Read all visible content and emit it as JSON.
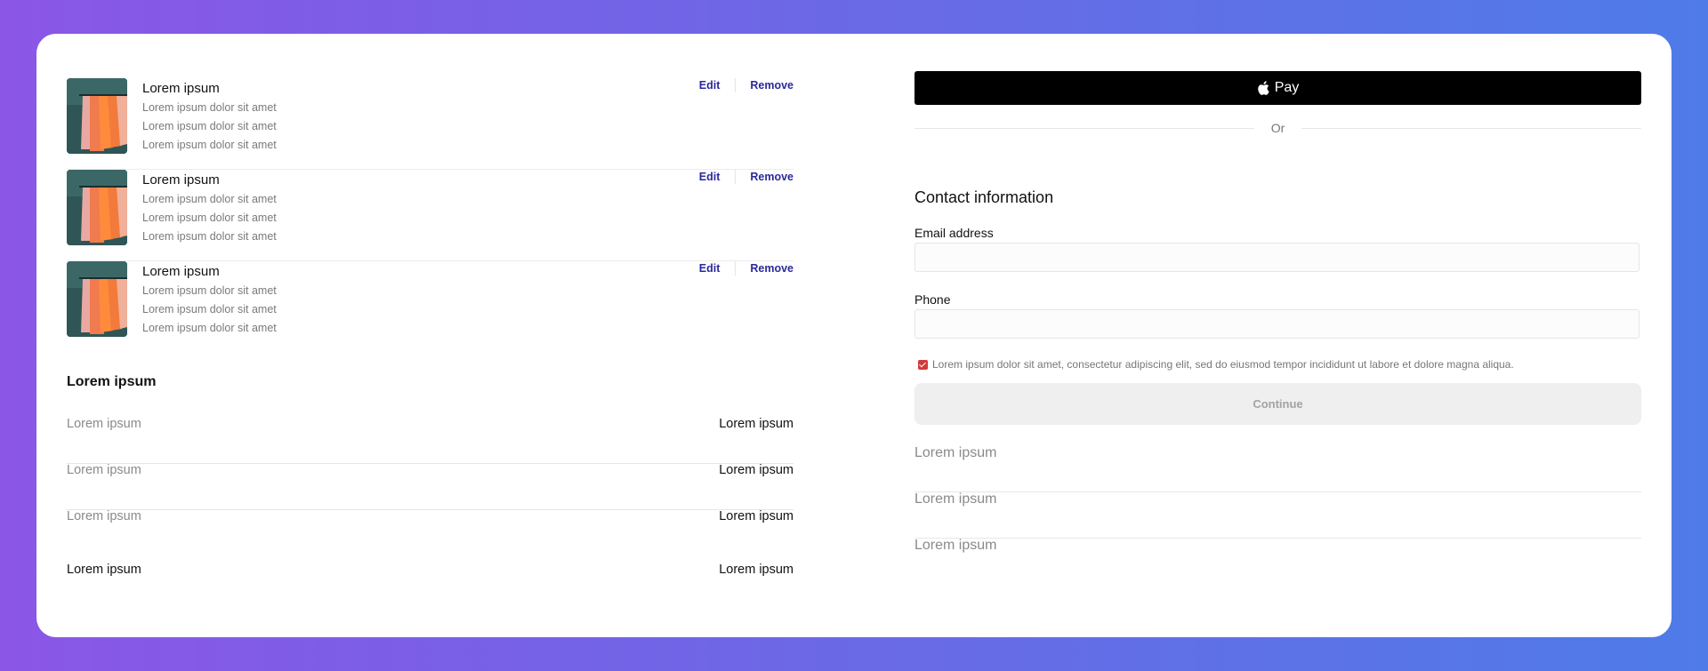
{
  "cart": {
    "items": [
      {
        "title": "Lorem ipsum",
        "lines": [
          "Lorem ipsum dolor sit amet",
          "Lorem ipsum dolor sit amet",
          "Lorem ipsum dolor sit amet"
        ],
        "edit": "Edit",
        "remove": "Remove"
      },
      {
        "title": "Lorem ipsum",
        "lines": [
          "Lorem ipsum dolor sit amet",
          "Lorem ipsum dolor sit amet",
          "Lorem ipsum dolor sit amet"
        ],
        "edit": "Edit",
        "remove": "Remove"
      },
      {
        "title": "Lorem ipsum",
        "lines": [
          "Lorem ipsum dolor sit amet",
          "Lorem ipsum dolor sit amet",
          "Lorem ipsum dolor sit amet"
        ],
        "edit": "Edit",
        "remove": "Remove"
      }
    ]
  },
  "summary": {
    "title": "Lorem ipsum",
    "rows": [
      {
        "label": "Lorem ipsum",
        "value": "Lorem ipsum"
      },
      {
        "label": "Lorem ipsum",
        "value": "Lorem ipsum"
      },
      {
        "label": "Lorem ipsum",
        "value": "Lorem ipsum"
      }
    ],
    "total": {
      "label": "Lorem ipsum",
      "value": "Lorem ipsum"
    }
  },
  "checkout": {
    "pay_label": "Pay",
    "pay_icon": "apple-icon",
    "or_label": "Or",
    "contact_title": "Contact information",
    "email_label": "Email address",
    "email_value": "",
    "phone_label": "Phone",
    "phone_value": "",
    "consent_text": "Lorem ipsum dolor sit amet, consectetur adipiscing elit, sed do eiusmod tempor incididunt ut labore et dolore magna aliqua.",
    "consent_checked": true,
    "continue_label": "Continue",
    "steps": [
      "Lorem ipsum",
      "Lorem ipsum",
      "Lorem ipsum"
    ]
  },
  "colors": {
    "accent": "#2b2a9c",
    "checkbox": "#d23b3b",
    "background_start": "#8b56e6",
    "background_end": "#4f7be8"
  }
}
